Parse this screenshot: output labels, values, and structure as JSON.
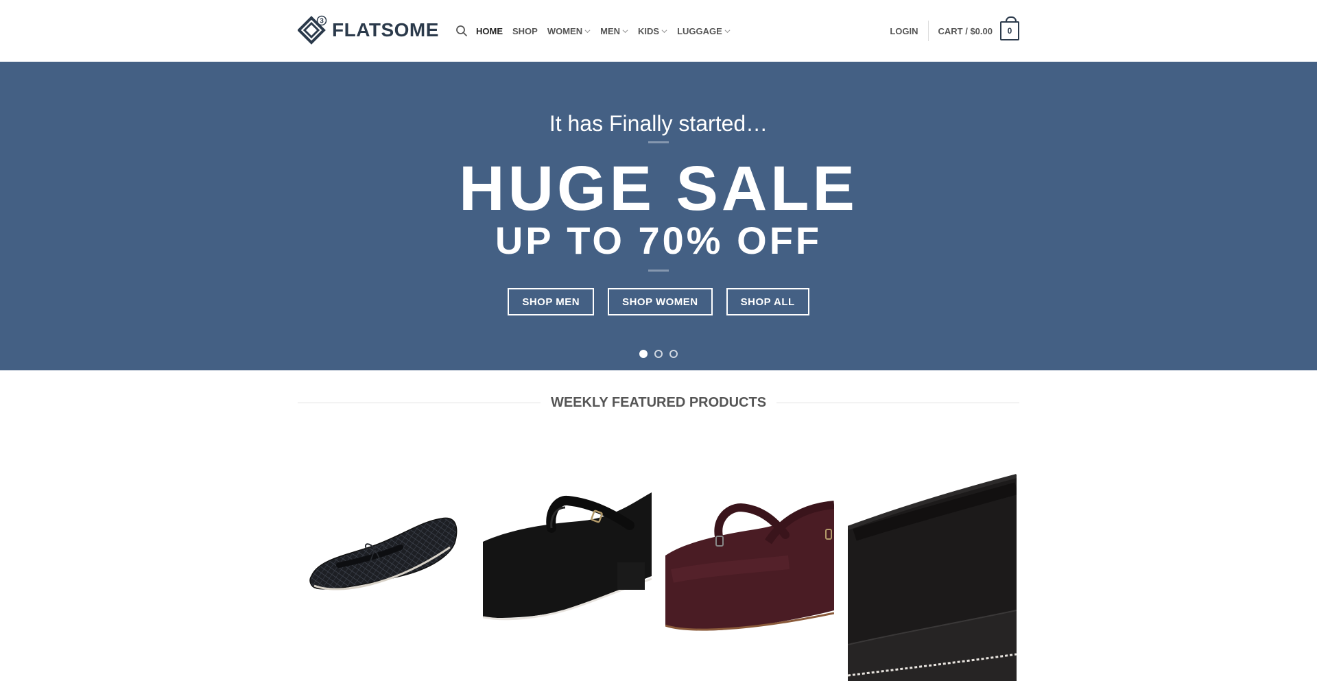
{
  "brand": {
    "name": "FLATSOME",
    "badge": "3",
    "color": "#2b3a4b"
  },
  "nav": {
    "search_icon": "search-icon",
    "items": [
      {
        "label": "HOME",
        "active": true,
        "dropdown": false
      },
      {
        "label": "SHOP",
        "active": false,
        "dropdown": false
      },
      {
        "label": "WOMEN",
        "active": false,
        "dropdown": true
      },
      {
        "label": "MEN",
        "active": false,
        "dropdown": true
      },
      {
        "label": "KIDS",
        "active": false,
        "dropdown": true
      },
      {
        "label": "LUGGAGE",
        "active": false,
        "dropdown": true
      }
    ]
  },
  "account": {
    "login_label": "LOGIN",
    "cart_label": "CART / $0.00",
    "cart_count": "0"
  },
  "hero": {
    "background": "#446084",
    "tagline": "It has Finally started…",
    "title": "HUGE SALE",
    "subtitle": "UP TO 70% OFF",
    "buttons": [
      "SHOP MEN",
      "SHOP WOMEN",
      "SHOP ALL"
    ],
    "slides": 3,
    "active_slide": 1
  },
  "featured": {
    "title": "WEEKLY FEATURED PRODUCTS",
    "products": [
      {
        "image": "black-woven-ballet-flat"
      },
      {
        "image": "black-suede-mary-jane"
      },
      {
        "image": "burgundy-suede-mary-jane"
      },
      {
        "image": "black-suede-flat-closeup"
      }
    ]
  }
}
